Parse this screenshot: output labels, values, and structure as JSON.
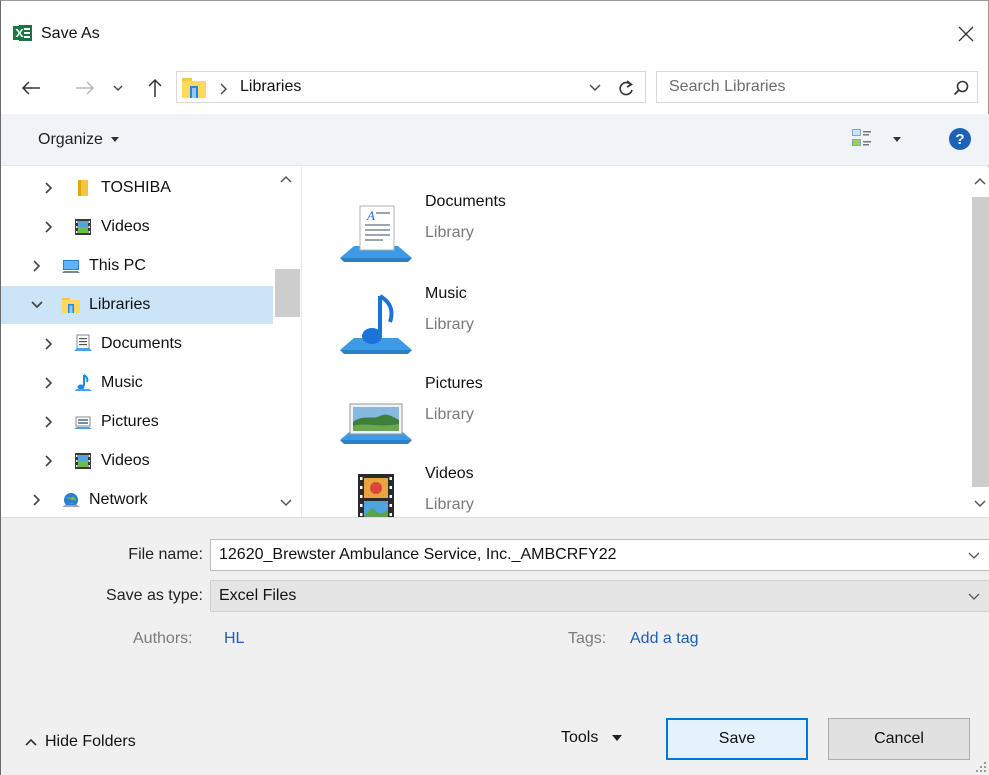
{
  "window": {
    "title": "Save As"
  },
  "address": {
    "path": "Libraries",
    "search_placeholder": "Search Libraries"
  },
  "toolbar": {
    "organize_label": "Organize"
  },
  "nav_pane": {
    "items": [
      {
        "label": "TOSHIBA",
        "icon": "folder-icon",
        "level": 1,
        "expanded": false,
        "selected": false
      },
      {
        "label": "Videos",
        "icon": "videos-icon",
        "level": 1,
        "expanded": false,
        "selected": false
      },
      {
        "label": "This PC",
        "icon": "computer-icon",
        "level": 0,
        "expanded": false,
        "selected": false
      },
      {
        "label": "Libraries",
        "icon": "libraries-icon",
        "level": 0,
        "expanded": true,
        "selected": true
      },
      {
        "label": "Documents",
        "icon": "documents-icon",
        "level": 1,
        "expanded": false,
        "selected": false
      },
      {
        "label": "Music",
        "icon": "music-icon",
        "level": 1,
        "expanded": false,
        "selected": false
      },
      {
        "label": "Pictures",
        "icon": "pictures-icon",
        "level": 1,
        "expanded": false,
        "selected": false
      },
      {
        "label": "Videos",
        "icon": "videos-icon",
        "level": 1,
        "expanded": false,
        "selected": false
      },
      {
        "label": "Network",
        "icon": "network-icon",
        "level": 0,
        "expanded": false,
        "selected": false
      }
    ]
  },
  "content": {
    "items": [
      {
        "name": "Documents",
        "type": "Library",
        "icon": "documents-library-icon"
      },
      {
        "name": "Music",
        "type": "Library",
        "icon": "music-library-icon"
      },
      {
        "name": "Pictures",
        "type": "Library",
        "icon": "pictures-library-icon"
      },
      {
        "name": "Videos",
        "type": "Library",
        "icon": "videos-library-icon"
      }
    ]
  },
  "form": {
    "file_name_label": "File name:",
    "file_name_value": "12620_Brewster Ambulance Service, Inc._AMBCRFY22",
    "save_type_label": "Save as type:",
    "save_type_value": "Excel Files",
    "authors_label": "Authors:",
    "authors_value": "HL",
    "tags_label": "Tags:",
    "tags_value": "Add a tag"
  },
  "footer": {
    "hide_folders_label": "Hide Folders",
    "tools_label": "Tools",
    "save_label": "Save",
    "cancel_label": "Cancel"
  },
  "colors": {
    "accent": "#0078d7",
    "selection": "#cce4f7",
    "link": "#1a5fb4",
    "excel": "#1d7044"
  }
}
